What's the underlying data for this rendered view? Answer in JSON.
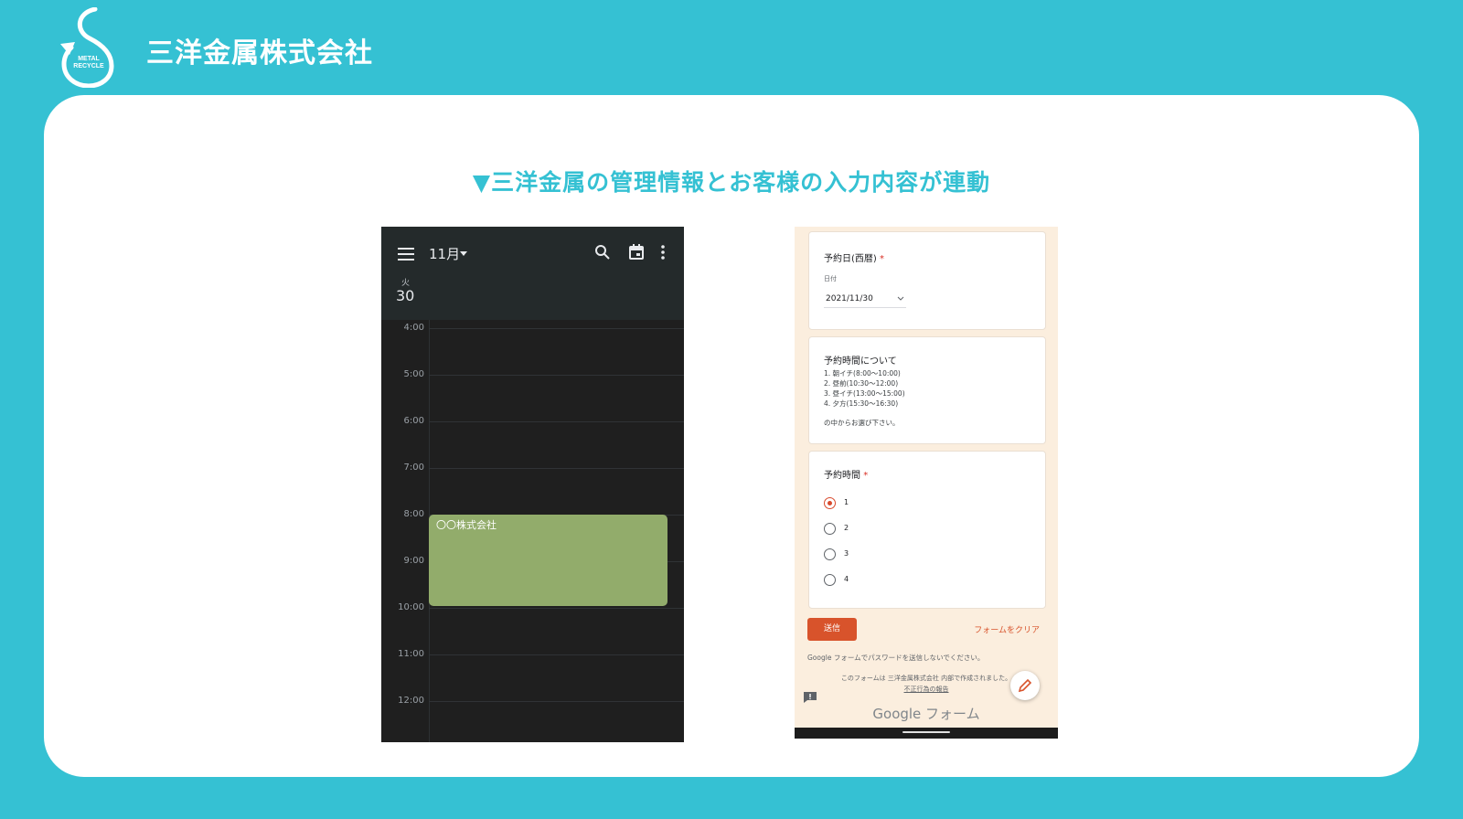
{
  "header": {
    "company_name": "三洋金属株式会社",
    "logo": {
      "icon": "recycle-s-logo",
      "text_line1": "METAL",
      "text_line2": "RECYCLE"
    }
  },
  "main": {
    "heading": "▼三洋金属の管理情報とお客様の入力内容が連動"
  },
  "calendar": {
    "month_label": "11月",
    "weekday": "火",
    "day": "30",
    "times": [
      "4:00",
      "5:00",
      "6:00",
      "7:00",
      "8:00",
      "9:00",
      "10:00",
      "11:00",
      "12:00"
    ],
    "event": {
      "title": "〇〇株式会社",
      "start": "8:00",
      "end": "10:00"
    },
    "colors": {
      "background": "#1f1f1f",
      "header": "#242a2b",
      "event": "#92ac6b"
    },
    "icons": [
      "menu-icon",
      "caret-down-icon",
      "search-icon",
      "calendar-icon",
      "more-vert-icon"
    ]
  },
  "form": {
    "date_question": {
      "title": "予約日(西暦)",
      "required_mark": "*",
      "sub_label": "日付",
      "value": "2021/11/30"
    },
    "info": {
      "title": "予約時間について",
      "lines": [
        "1. 朝イチ(8:00～10:00)",
        "2. 昼前(10:30～12:00)",
        "3. 昼イチ(13:00～15:00)",
        "4. 夕方(15:30～16:30)"
      ],
      "footer": "の中からお選び下さい。"
    },
    "time_question": {
      "title": "予約時間",
      "required_mark": "*",
      "options": [
        "1",
        "2",
        "3",
        "4"
      ],
      "selected": "1"
    },
    "submit_label": "送信",
    "clear_label": "フォームをクリア",
    "disclaimer": "Google フォームでパスワードを送信しないでください。",
    "created_note": "このフォームは 三洋金属株式会社 内部で作成されました。",
    "abuse_link": "不正行為の報告",
    "brand_text": "Google フォーム",
    "colors": {
      "background": "#fbeede",
      "accent": "#d8532b"
    },
    "icons": [
      "feedback-icon",
      "edit-icon"
    ]
  },
  "colors": {
    "brand": "#35c1d3",
    "card": "#ffffff"
  }
}
